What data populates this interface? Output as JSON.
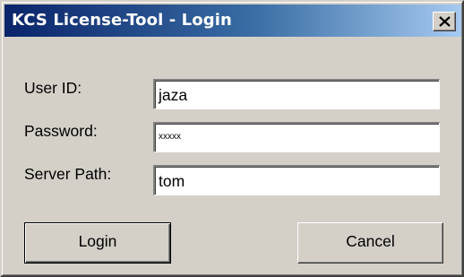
{
  "window": {
    "title": "KCS License-Tool - Login",
    "close_icon": "close-icon"
  },
  "form": {
    "user_id": {
      "label": "User ID:",
      "value": "jaza"
    },
    "password": {
      "label": "Password:",
      "value": "xxxxx"
    },
    "server_path": {
      "label": "Server Path:",
      "value": "tom"
    }
  },
  "buttons": {
    "login_label": "Login",
    "cancel_label": "Cancel"
  },
  "colors": {
    "titlebar_start": "#0a246a",
    "titlebar_end": "#a6caf0",
    "face": "#d4d0c8"
  }
}
